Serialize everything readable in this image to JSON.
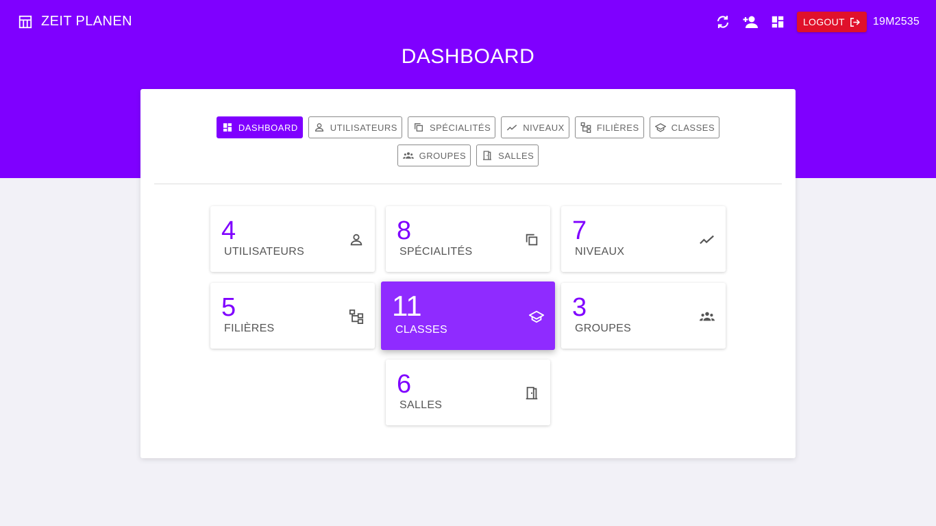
{
  "app": {
    "title": "ZEIT PLANEN"
  },
  "header": {
    "page_title": "DASHBOARD",
    "logout_label": "LOGOUT",
    "user_code": "19M2535"
  },
  "tabs": [
    {
      "label": "DASHBOARD",
      "icon": "dashboard-icon",
      "active": true
    },
    {
      "label": "UTILISATEURS",
      "icon": "person-icon"
    },
    {
      "label": "SPÉCIALITÉS",
      "icon": "copy-icon"
    },
    {
      "label": "NIVEAUX",
      "icon": "trend-icon"
    },
    {
      "label": "FILIÈRES",
      "icon": "tree-icon"
    },
    {
      "label": "CLASSES",
      "icon": "school-icon"
    },
    {
      "label": "GROUPES",
      "icon": "groups-icon"
    },
    {
      "label": "SALLES",
      "icon": "door-icon"
    }
  ],
  "stats": [
    {
      "count": "4",
      "label": "UTILISATEURS",
      "icon": "person-icon"
    },
    {
      "count": "8",
      "label": "SPÉCIALITÉS",
      "icon": "copy-icon"
    },
    {
      "count": "7",
      "label": "NIVEAUX",
      "icon": "trend-icon"
    },
    {
      "count": "5",
      "label": "FILIÈRES",
      "icon": "tree-icon"
    },
    {
      "count": "11",
      "label": "CLASSES",
      "icon": "school-icon",
      "highlighted": true
    },
    {
      "count": "3",
      "label": "GROUPES",
      "icon": "groups-icon"
    },
    {
      "count": "6",
      "label": "SALLES",
      "icon": "door-icon"
    }
  ],
  "colors": {
    "primary": "#7f00ff",
    "highlight": "#8f2bff",
    "logout": "#e0112b",
    "background": "#f2f1f7"
  }
}
